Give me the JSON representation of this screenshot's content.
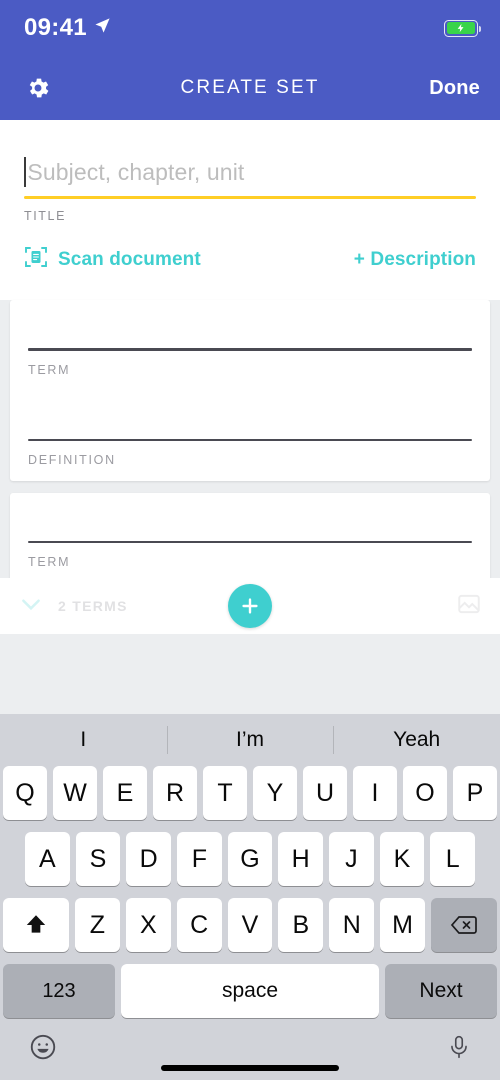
{
  "status_bar": {
    "time": "09:41",
    "location_icon": "location-arrow-icon",
    "battery_icon": "battery-charging-icon"
  },
  "nav_bar": {
    "settings_icon": "gear-icon",
    "title": "CREATE SET",
    "done_label": "Done"
  },
  "title_section": {
    "placeholder": "Subject, chapter, unit",
    "value": "",
    "label": "TITLE",
    "underline_color": "#ffce26",
    "scan_icon": "scan-document-icon",
    "scan_label": "Scan document",
    "description_label": "+ Description"
  },
  "cards": [
    {
      "term": {
        "value": "",
        "label": "TERM"
      },
      "definition": {
        "value": "",
        "label": "DEFINITION"
      }
    },
    {
      "term": {
        "value": "",
        "label": "TERM"
      }
    }
  ],
  "bottom_bar": {
    "chevron_icon": "chevron-down-icon",
    "terms_count": "2 TERMS",
    "add_icon": "plus-icon",
    "image_icon": "image-icon",
    "accent_color": "#3fcfcf"
  },
  "keyboard": {
    "suggestions": [
      "I",
      "I’m",
      "Yeah"
    ],
    "row1": [
      "Q",
      "W",
      "E",
      "R",
      "T",
      "Y",
      "U",
      "I",
      "O",
      "P"
    ],
    "row2": [
      "A",
      "S",
      "D",
      "F",
      "G",
      "H",
      "J",
      "K",
      "L"
    ],
    "row3": [
      "Z",
      "X",
      "C",
      "V",
      "B",
      "N",
      "M"
    ],
    "shift_icon": "shift-arrow-icon",
    "delete_icon": "backspace-icon",
    "numbers_label": "123",
    "space_label": "space",
    "return_label": "Next",
    "emoji_icon": "emoji-smiley-icon",
    "mic_icon": "microphone-icon"
  },
  "theme": {
    "header_blue": "#4b5bc4",
    "teal": "#3fcfcf",
    "yellow": "#ffce26"
  }
}
